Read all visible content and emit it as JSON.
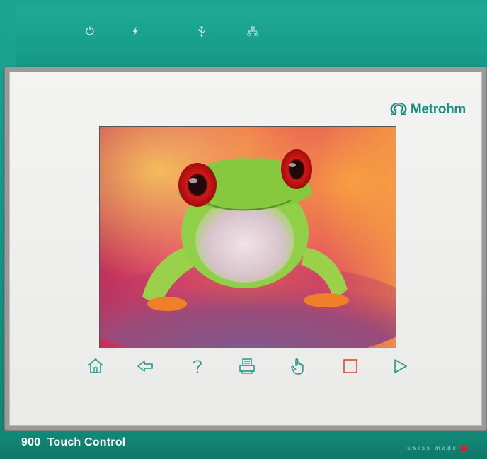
{
  "device": {
    "logo_text": "Metrohm",
    "model_label": "900  Touch Control",
    "swiss_made": "swiss made",
    "colors": {
      "housing_teal": "#179585",
      "logo_teal": "#1a8e80",
      "nav_teal": "#1e9a8a",
      "stop_red": "#e0503c",
      "bezel_grey": "#9a9a98"
    }
  },
  "status_icons": [
    "power-icon",
    "lightning-icon",
    "usb-icon",
    "network-icon"
  ],
  "screen": {
    "content": "tree-frog-image"
  },
  "nav_buttons": [
    {
      "name": "home-button",
      "icon": "home-icon"
    },
    {
      "name": "back-button",
      "icon": "back-arrow-icon"
    },
    {
      "name": "help-button",
      "icon": "question-icon",
      "label": "?"
    },
    {
      "name": "print-button",
      "icon": "printer-icon"
    },
    {
      "name": "manual-button",
      "icon": "hand-icon"
    },
    {
      "name": "stop-button",
      "icon": "stop-square-icon"
    },
    {
      "name": "start-button",
      "icon": "play-icon"
    }
  ]
}
